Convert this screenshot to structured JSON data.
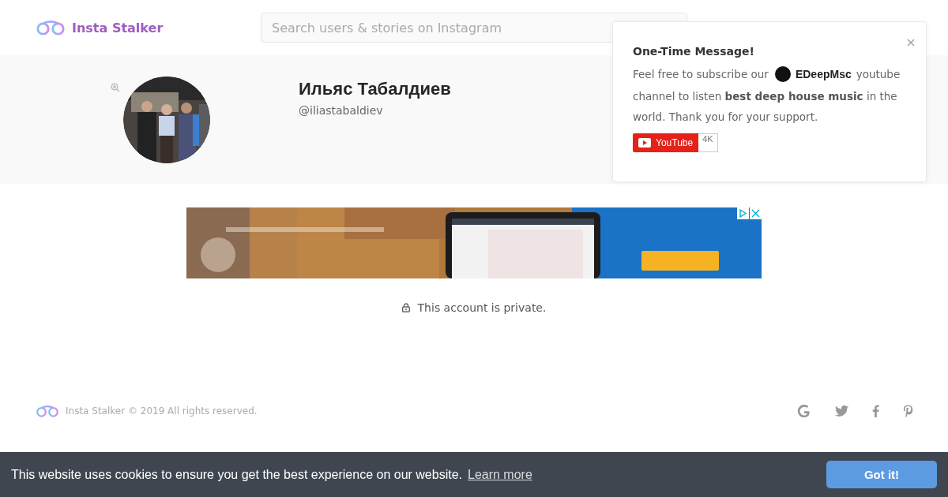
{
  "header": {
    "brand": "Insta Stalker",
    "search": {
      "placeholder": "Search users & stories on Instagram"
    }
  },
  "profile": {
    "name": "Ильяс Табалдиев",
    "username": "@iliastabaldiev"
  },
  "popup": {
    "title": "One-Time Message!",
    "text_before": "Feel free to subscribe our",
    "channel": "EDeepMsc",
    "text_after_channel": "youtube",
    "text_rest": "channel to listen **best deep house music** in the world. Thank you for your support.",
    "youtube_button": "YouTube",
    "subscriber_count": "4K"
  },
  "private_notice": "This account is private.",
  "footer": {
    "copyright": "Insta Stalker © 2019 All rights reserved."
  },
  "cookie_bar": {
    "message": "This website uses cookies to ensure you get the best experience on our website.",
    "link": "Learn more",
    "button": "Got it!"
  }
}
